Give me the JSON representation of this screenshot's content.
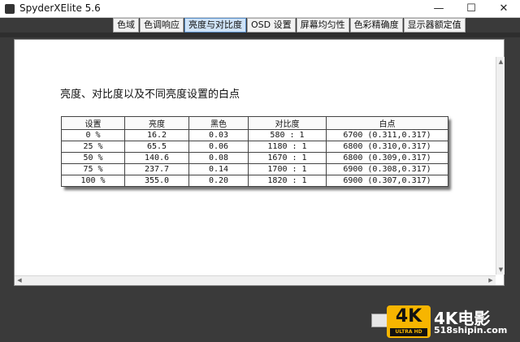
{
  "window": {
    "title": "SpyderXElite 5.6",
    "minimize_glyph": "—",
    "maximize_glyph": "☐",
    "close_glyph": "✕"
  },
  "tabs": [
    {
      "label": "色域",
      "active": false
    },
    {
      "label": "色调响应",
      "active": false
    },
    {
      "label": "亮度与对比度",
      "active": true
    },
    {
      "label": "OSD 设置",
      "active": false
    },
    {
      "label": "屏幕均匀性",
      "active": false
    },
    {
      "label": "色彩精确度",
      "active": false
    },
    {
      "label": "显示器额定值",
      "active": false
    }
  ],
  "zoom": {
    "zoom_in_icon": "zoom-in-icon",
    "zoom_out_icon": "zoom-out-icon",
    "zoom_fit_icon": "zoom-fit-icon",
    "plus": "+",
    "minus": "−"
  },
  "report": {
    "title": "亮度、对比度以及不同亮度设置的白点",
    "table": {
      "headers": [
        "设置",
        "亮度",
        "黑色",
        "对比度",
        "白点"
      ],
      "rows": [
        [
          "0 %",
          "16.2",
          "0.03",
          "580 : 1",
          "6700 (0.311,0.317)"
        ],
        [
          "25 %",
          "65.5",
          "0.06",
          "1180 : 1",
          "6800 (0.310,0.317)"
        ],
        [
          "50 %",
          "140.6",
          "0.08",
          "1670 : 1",
          "6800 (0.309,0.317)"
        ],
        [
          "75 %",
          "237.7",
          "0.14",
          "1700 : 1",
          "6900 (0.308,0.317)"
        ],
        [
          "100 %",
          "355.0",
          "0.20",
          "1820 : 1",
          "6900 (0.307,0.317)"
        ]
      ]
    }
  },
  "scrollbar": {
    "up": "▲",
    "down": "▼",
    "left": "◀",
    "right": "▶"
  },
  "watermark": {
    "badge": "4K",
    "badge_sub": "ULTRA HD",
    "brand": "4K电影",
    "url": "518shipin.com"
  }
}
